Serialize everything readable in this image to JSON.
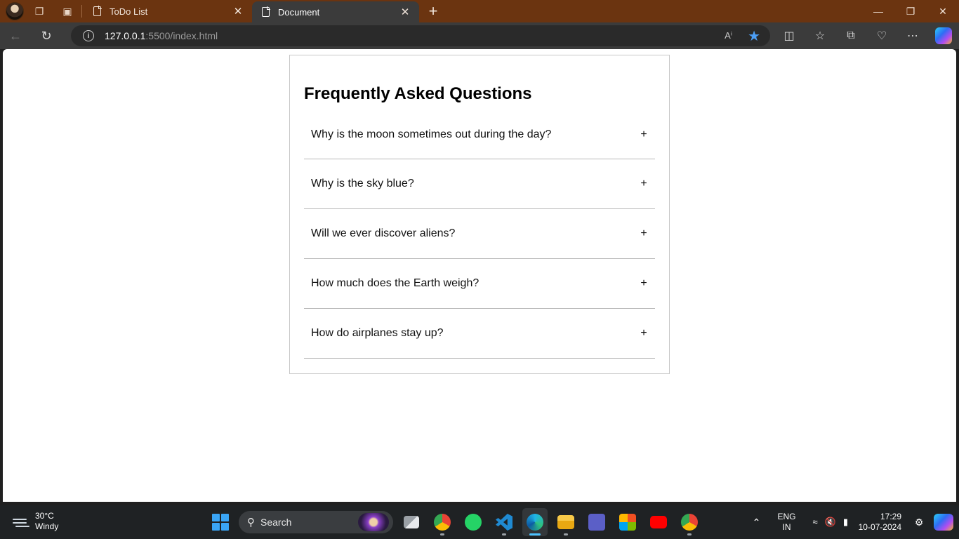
{
  "browser": {
    "tabs": [
      {
        "label": "ToDo List",
        "active": false
      },
      {
        "label": "Document",
        "active": true
      }
    ],
    "address": {
      "host": "127.0.0.1",
      "path": ":5500/index.html"
    }
  },
  "page": {
    "title": "Frequently Asked Questions",
    "faqs": [
      {
        "question": "Why is the moon sometimes out during the day?",
        "toggle": "+"
      },
      {
        "question": "Why is the sky blue?",
        "toggle": "+"
      },
      {
        "question": "Will we ever discover aliens?",
        "toggle": "+"
      },
      {
        "question": "How much does the Earth weigh?",
        "toggle": "+"
      },
      {
        "question": "How do airplanes stay up?",
        "toggle": "+"
      }
    ]
  },
  "taskbar": {
    "weather": {
      "temp": "30°C",
      "condition": "Windy"
    },
    "search_placeholder": "Search",
    "language": {
      "line1": "ENG",
      "line2": "IN"
    },
    "clock": {
      "time": "17:29",
      "date": "10-07-2024"
    },
    "apps": [
      "file-explorer-taskview-icon",
      "chrome-icon",
      "whatsapp-icon",
      "vscode-icon",
      "edge-icon",
      "folder-icon",
      "teams-icon",
      "store-icon",
      "youtube-icon",
      "chrome-icon"
    ]
  },
  "colors": {
    "titlebar": "#6b3410",
    "toolbar": "#3b3b3b",
    "accent": "#4c9ef5"
  }
}
